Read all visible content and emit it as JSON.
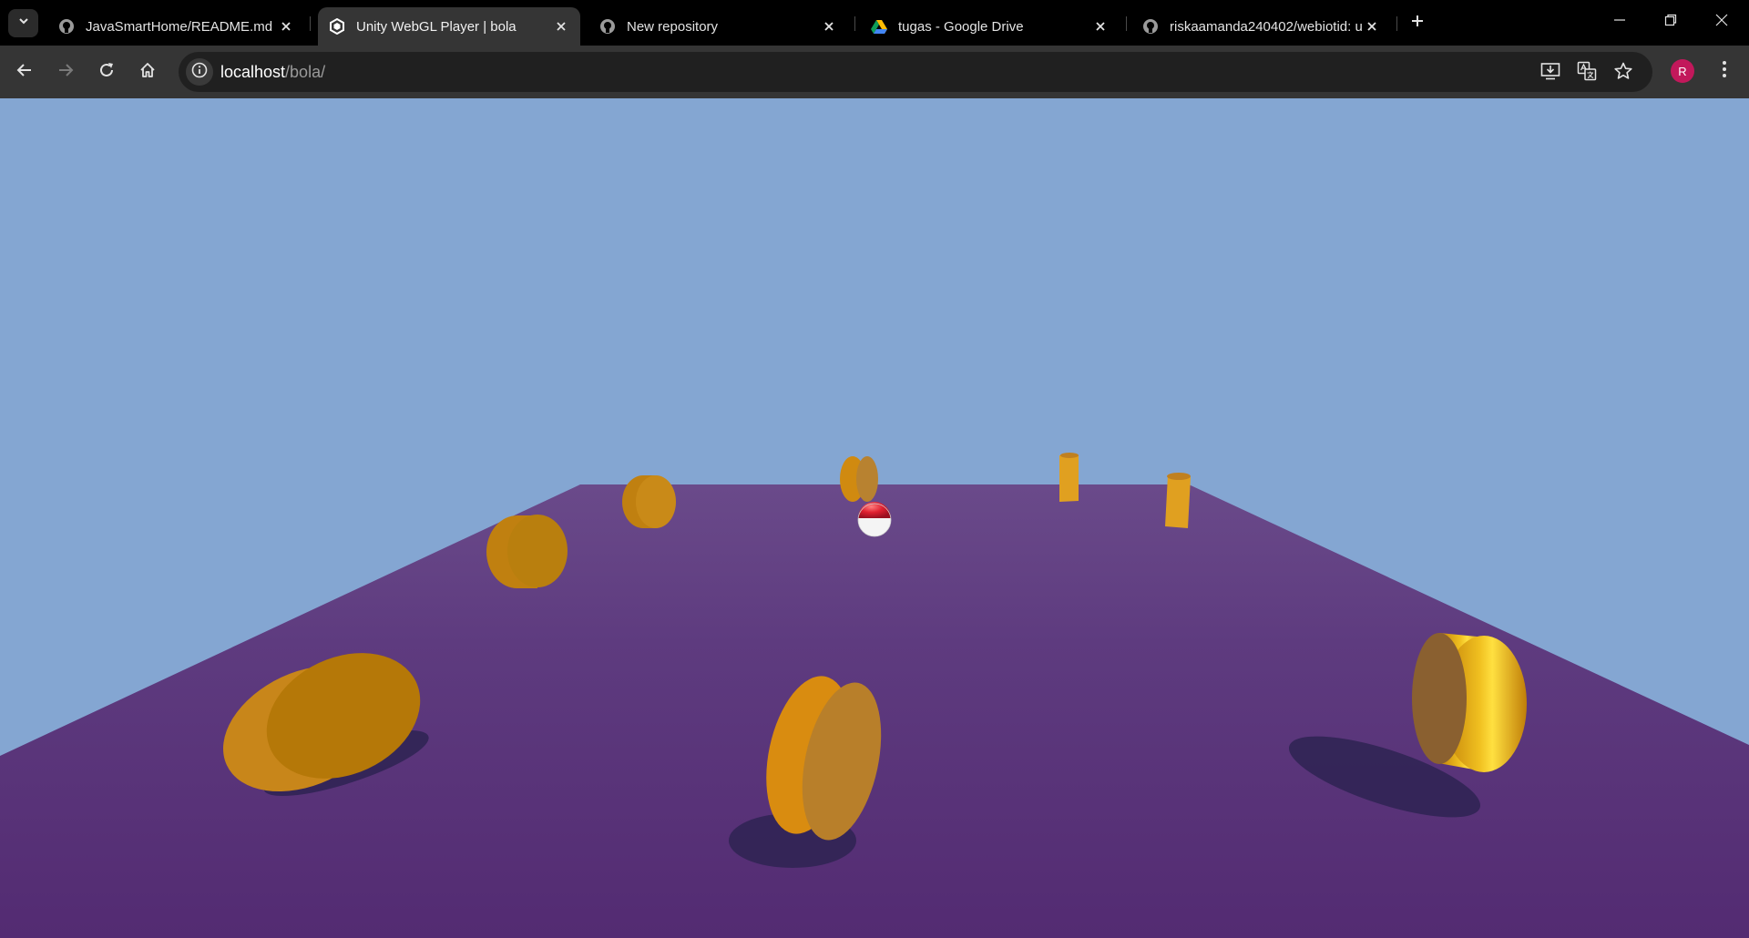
{
  "browser": {
    "tabs": [
      {
        "title": "JavaSmartHome/README.md a",
        "icon": "github-icon",
        "active": false
      },
      {
        "title": "Unity WebGL Player | bola",
        "icon": "unity-icon",
        "active": true
      },
      {
        "title": "New repository",
        "icon": "github-icon",
        "active": false
      },
      {
        "title": "tugas - Google Drive",
        "icon": "google-drive-icon",
        "active": false
      },
      {
        "title": "riskaamanda240402/webiotid: u",
        "icon": "github-icon",
        "active": false
      }
    ],
    "address": {
      "host": "localhost",
      "path": "/bola/"
    },
    "profile_initial": "R"
  },
  "game": {
    "title": "bola",
    "sky_color": "#84a6d2",
    "floor_color": "#5a3578",
    "obstacle_color": "#c8820e",
    "ball_colors": [
      "#e02030",
      "#ffffff"
    ]
  }
}
